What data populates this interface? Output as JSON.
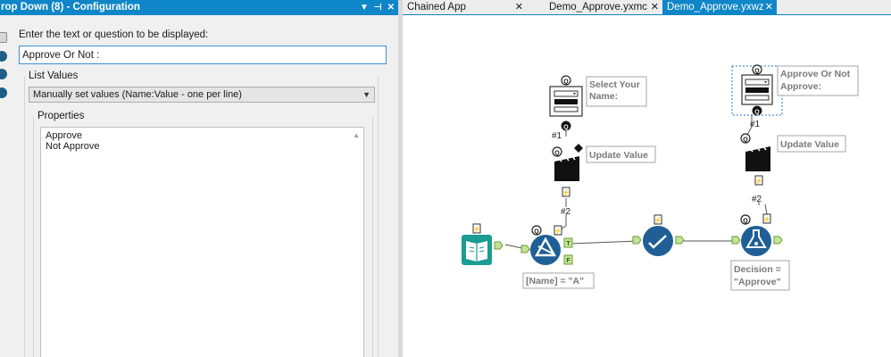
{
  "config_panel": {
    "title": "rop Down (8) - Configuration",
    "title_controls": [
      "▼",
      "⊣",
      "✕"
    ],
    "prompt_label": "Enter the text or question to be displayed:",
    "prompt_value": "Approve Or Not :",
    "list_values_label": "List Values",
    "list_values_selected": "Manually set values (Name:Value - one per line)",
    "properties_label": "Properties",
    "properties_lines": [
      "Approve",
      "Not Approve"
    ]
  },
  "tabs": [
    {
      "label": "Chained App Example.yxwz*",
      "close": "✕",
      "active": false
    },
    {
      "label": "Demo_Approve.yxmc",
      "close": "✕",
      "active": false
    },
    {
      "label": "Demo_Approve.yxwz",
      "close": "✕",
      "active": true
    }
  ],
  "canvas": {
    "annotations": {
      "select_name": [
        "Select Your",
        "Name:"
      ],
      "approve_or_not": [
        "Approve Or Not",
        "Approve:"
      ],
      "update_value_1": "Update Value",
      "update_value_2": "Update Value",
      "filter_expr": "[Name] = \"A\"",
      "decision": [
        "Decision =",
        "\"Approve\""
      ]
    },
    "connection_labels": {
      "hash1_left": "#1",
      "hash2_left": "#2",
      "hash1_right": "#1",
      "hash2_right": "#2"
    },
    "anchor_letters": {
      "q": "Q",
      "t": "T",
      "f": "F",
      "lightning": "⚡"
    },
    "colors": {
      "accent": "#0f86c7",
      "tool_blue": "#1f5f95",
      "input_teal": "#1a9c92",
      "anchor_green": "#8dc63f"
    },
    "icons": [
      "dropdown-tool-icon",
      "action-tool-icon",
      "text-input-tool-icon",
      "filter-tool-icon",
      "condition-tool-icon",
      "macro-output-icon"
    ]
  }
}
